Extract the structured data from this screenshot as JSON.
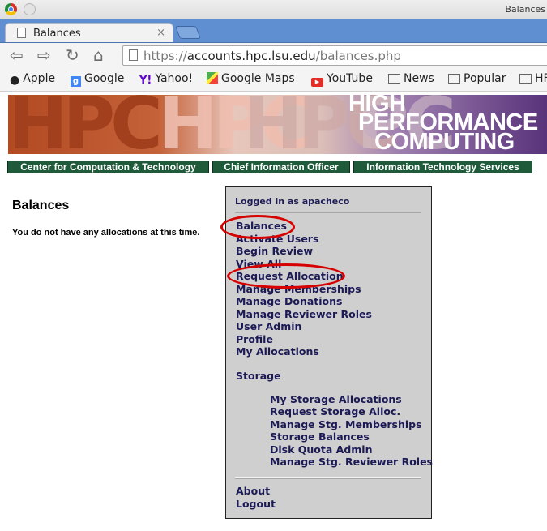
{
  "window": {
    "title": "Balances"
  },
  "tab": {
    "label": "Balances",
    "close": "×"
  },
  "address": {
    "scheme": "https://",
    "host": "accounts.hpc.lsu.edu",
    "path": "/balances.php"
  },
  "bookmarks": [
    {
      "label": "Apple",
      "icon": "apple-icon"
    },
    {
      "label": "Google",
      "icon": "google-icon"
    },
    {
      "label": "Yahoo!",
      "icon": "yahoo-icon"
    },
    {
      "label": "Google Maps",
      "icon": "maps-icon"
    },
    {
      "label": "YouTube",
      "icon": "youtube-icon"
    },
    {
      "label": "News",
      "icon": "folder-icon"
    },
    {
      "label": "Popular",
      "icon": "folder-icon"
    },
    {
      "label": "HF",
      "icon": "folder-icon"
    }
  ],
  "banner": {
    "big1": "HPC",
    "big2": "HPC",
    "big3": "HPC",
    "big4": "PC",
    "line1": "HIGH",
    "line2": "PERFORMANCE",
    "line3": "COMPUTING"
  },
  "nav": [
    "Center for Computation & Technology",
    "Chief Information Officer",
    "Information Technology Services"
  ],
  "page": {
    "title": "Balances",
    "message": "You do not have any allocations at this time."
  },
  "sidebar": {
    "logged_in": "Logged in as apacheco",
    "links": [
      "Balances",
      "Activate Users",
      "Begin Review",
      "View All",
      "Request Allocation",
      "Manage Memberships",
      "Manage Donations",
      "Manage Reviewer Roles",
      "User Admin",
      "Profile",
      "My Allocations"
    ],
    "storage_heading": "Storage",
    "storage_links": [
      "My Storage Allocations",
      "Request Storage Alloc.",
      "Manage Stg. Memberships",
      "Storage Balances",
      "Disk Quota Admin",
      "Manage Stg. Reviewer Roles"
    ],
    "footer_links": [
      "About",
      "Logout"
    ]
  },
  "colors": {
    "nav_bg": "#1f5a3a",
    "link": "#1c1a55",
    "sidebar_bg": "#cfcfcf",
    "highlight": "#d60000",
    "tabstrip": "#5f8fd0"
  }
}
